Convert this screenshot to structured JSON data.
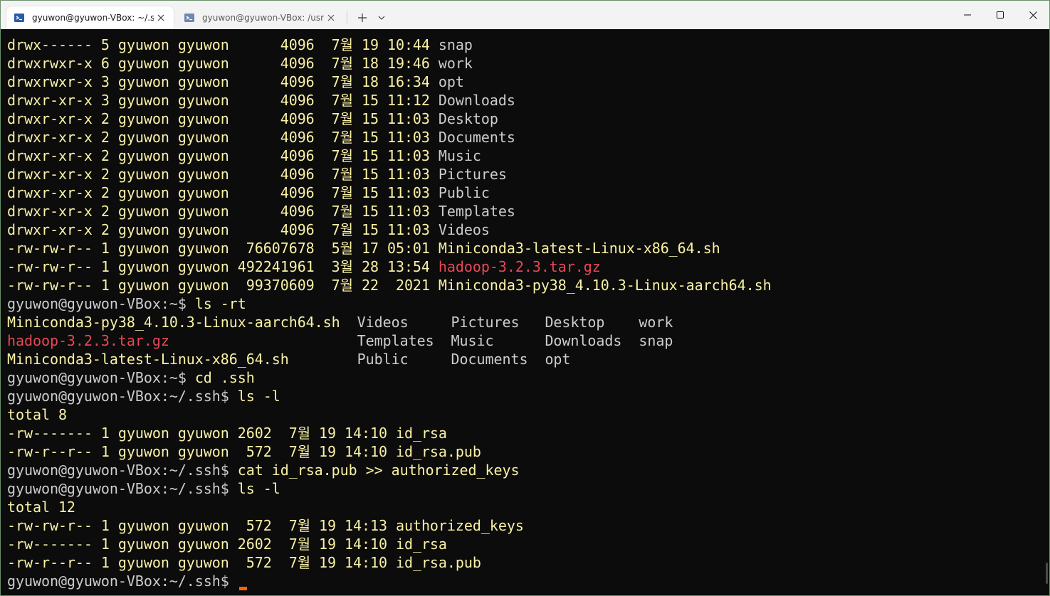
{
  "tabs": [
    {
      "title": "gyuwon@gyuwon-VBox: ~/.ssh",
      "icon": "terminal-icon",
      "active": true
    },
    {
      "title": "gyuwon@gyuwon-VBox: /usr/local",
      "icon": "terminal-icon",
      "active": false
    }
  ],
  "colors": {
    "titlebar": "#f3f3f3",
    "terminal_bg": "#0c0c0c",
    "file_text": "#f9f1a5",
    "dir_text": "#cccccc",
    "archive_text": "#e74856",
    "cursor": "#f7630c"
  },
  "window_buttons": {
    "minimize": "minimize-icon",
    "maximize": "maximize-icon",
    "close": "close-icon"
  },
  "terminal": {
    "listing1": [
      {
        "meta": "drwx------ 5 gyuwon gyuwon      4096  7월 19 10:44 ",
        "name": "snap",
        "kind": "dir"
      },
      {
        "meta": "drwxrwxr-x 6 gyuwon gyuwon      4096  7월 18 19:46 ",
        "name": "work",
        "kind": "dir"
      },
      {
        "meta": "drwxrwxr-x 3 gyuwon gyuwon      4096  7월 18 16:34 ",
        "name": "opt",
        "kind": "dir"
      },
      {
        "meta": "drwxr-xr-x 3 gyuwon gyuwon      4096  7월 15 11:12 ",
        "name": "Downloads",
        "kind": "dir"
      },
      {
        "meta": "drwxr-xr-x 2 gyuwon gyuwon      4096  7월 15 11:03 ",
        "name": "Desktop",
        "kind": "dir"
      },
      {
        "meta": "drwxr-xr-x 2 gyuwon gyuwon      4096  7월 15 11:03 ",
        "name": "Documents",
        "kind": "dir"
      },
      {
        "meta": "drwxr-xr-x 2 gyuwon gyuwon      4096  7월 15 11:03 ",
        "name": "Music",
        "kind": "dir"
      },
      {
        "meta": "drwxr-xr-x 2 gyuwon gyuwon      4096  7월 15 11:03 ",
        "name": "Pictures",
        "kind": "dir"
      },
      {
        "meta": "drwxr-xr-x 2 gyuwon gyuwon      4096  7월 15 11:03 ",
        "name": "Public",
        "kind": "dir"
      },
      {
        "meta": "drwxr-xr-x 2 gyuwon gyuwon      4096  7월 15 11:03 ",
        "name": "Templates",
        "kind": "dir"
      },
      {
        "meta": "drwxr-xr-x 2 gyuwon gyuwon      4096  7월 15 11:03 ",
        "name": "Videos",
        "kind": "dir"
      },
      {
        "meta": "-rw-rw-r-- 1 gyuwon gyuwon  76607678  5월 17 05:01 ",
        "name": "Miniconda3-latest-Linux-x86_64.sh",
        "kind": "file"
      },
      {
        "meta": "-rw-rw-r-- 1 gyuwon gyuwon 492241961  3월 28 13:54 ",
        "name": "hadoop-3.2.3.tar.gz",
        "kind": "archive"
      },
      {
        "meta": "-rw-rw-r-- 1 gyuwon gyuwon  99370609  7월 22  2021 ",
        "name": "Miniconda3-py38_4.10.3-Linux-aarch64.sh",
        "kind": "file"
      }
    ],
    "prompt_home": "gyuwon@gyuwon-VBox:~$ ",
    "prompt_ssh": "gyuwon@gyuwon-VBox:~/.ssh$ ",
    "cmd_ls_rt": "ls -rt",
    "lsrt_rows": [
      {
        "c1": "Miniconda3-py38_4.10.3-Linux-aarch64.sh  ",
        "c1kind": "file",
        "rest": "Videos     Pictures   Desktop    work"
      },
      {
        "c1": "hadoop-3.2.3.tar.gz                      ",
        "c1kind": "archive",
        "rest": "Templates  Music      Downloads  snap"
      },
      {
        "c1": "Miniconda3-latest-Linux-x86_64.sh        ",
        "c1kind": "file",
        "rest": "Public     Documents  opt"
      }
    ],
    "cmd_cd": "cd .ssh",
    "cmd_ls_l": "ls -l",
    "total1": "total 8",
    "listing2": [
      {
        "meta": "-rw------- 1 gyuwon gyuwon 2602  7월 19 14:10 ",
        "name": "id_rsa"
      },
      {
        "meta": "-rw-r--r-- 1 gyuwon gyuwon  572  7월 19 14:10 ",
        "name": "id_rsa.pub"
      }
    ],
    "cmd_cat": "cat id_rsa.pub >> authorized_keys",
    "total2": "total 12",
    "listing3": [
      {
        "meta": "-rw-rw-r-- 1 gyuwon gyuwon  572  7월 19 14:13 ",
        "name": "authorized_keys"
      },
      {
        "meta": "-rw------- 1 gyuwon gyuwon 2602  7월 19 14:10 ",
        "name": "id_rsa"
      },
      {
        "meta": "-rw-r--r-- 1 gyuwon gyuwon  572  7월 19 14:10 ",
        "name": "id_rsa.pub"
      }
    ]
  }
}
